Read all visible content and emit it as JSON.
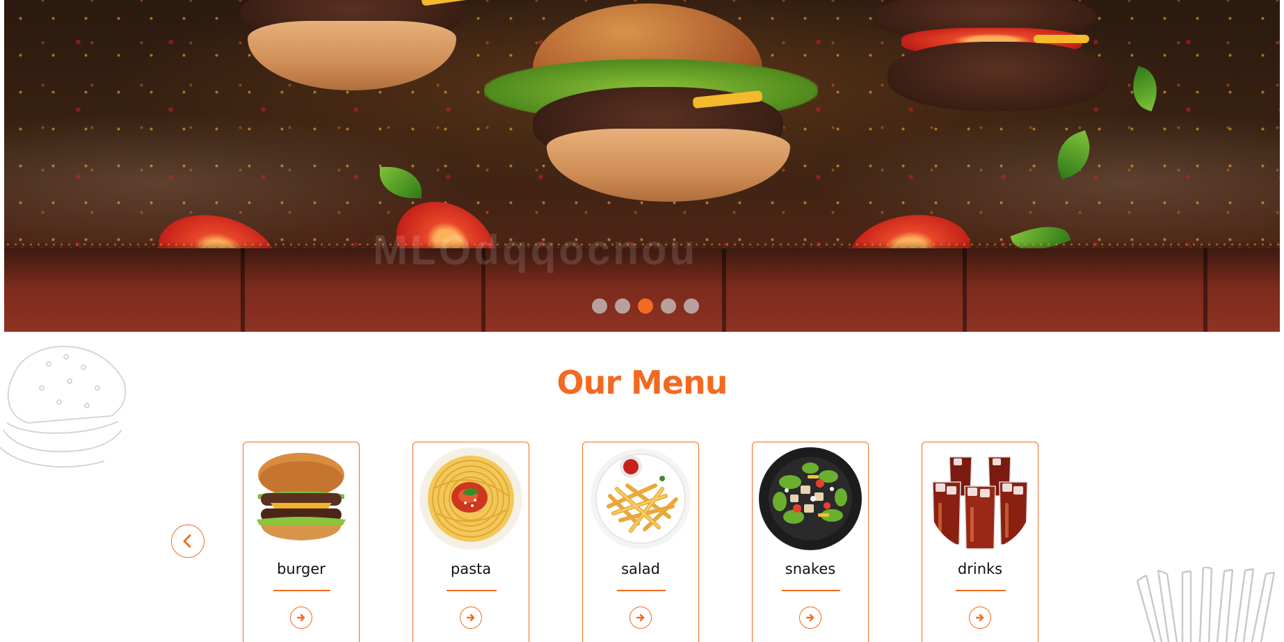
{
  "hero": {
    "watermark": "MLOdqqocnou",
    "slides": [
      {
        "label": "slide 1",
        "active": false
      },
      {
        "label": "slide 2",
        "active": false
      },
      {
        "label": "slide 3",
        "active": true
      },
      {
        "label": "slide 4",
        "active": false
      },
      {
        "label": "slide 5",
        "active": false
      }
    ]
  },
  "menu": {
    "title": "Our Menu",
    "prev_icon": "chevron-left-icon",
    "items": [
      {
        "label": "burger",
        "icon": "burger-image"
      },
      {
        "label": "pasta",
        "icon": "pasta-image"
      },
      {
        "label": "salad",
        "icon": "fries-image"
      },
      {
        "label": "snakes",
        "icon": "salad-bowl-image"
      },
      {
        "label": "drinks",
        "icon": "cola-glasses-image"
      }
    ],
    "item_button_icon": "arrow-right-circle-icon"
  },
  "colors": {
    "accent": "#f26a21",
    "text": "#111111",
    "background": "#ffffff"
  }
}
